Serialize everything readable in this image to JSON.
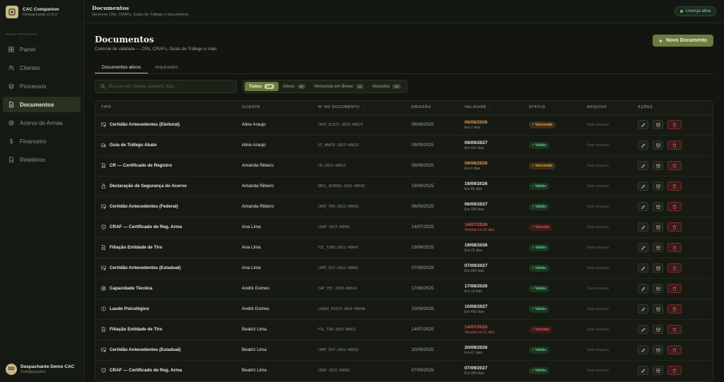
{
  "app": {
    "name": "CAC Companion",
    "version": "Despachante v1.0.0"
  },
  "sidebar": {
    "menu_label": "MENU PRINCIPAL",
    "items": [
      {
        "label": "Painel",
        "icon": "grid-icon",
        "active": false
      },
      {
        "label": "Clientes",
        "icon": "users-icon",
        "active": false
      },
      {
        "label": "Processos",
        "icon": "layers-icon",
        "active": false
      },
      {
        "label": "Documentos",
        "icon": "document-icon",
        "active": true
      },
      {
        "label": "Acervo de Armas",
        "icon": "target-icon",
        "active": false
      },
      {
        "label": "Financeiro",
        "icon": "dollar-icon",
        "active": false
      },
      {
        "label": "Relatórios",
        "icon": "chart-icon",
        "active": false
      }
    ],
    "user": {
      "initials": "DD",
      "name": "Despachante Demo CAC",
      "sub": "Configurações"
    }
  },
  "topbar": {
    "title": "Documentos",
    "subtitle": "Gerencie CRs, CRAFs, Guias de Tráfego e documentos",
    "license": "Licença ativa"
  },
  "page": {
    "title": "Documentos",
    "subtitle": "Controle de validade — CRs, CRAFs, Guias de Tráfego e mais",
    "new_button": "Novo Documento"
  },
  "tabs": [
    {
      "label": "Documentos ativos",
      "active": true
    },
    {
      "label": "Arquivados",
      "active": false
    }
  ],
  "search": {
    "placeholder": "Buscar por cliente, número, tipo...",
    "value": ""
  },
  "filters": [
    {
      "label": "Todos",
      "count": "100",
      "active": true
    },
    {
      "label": "Ativos",
      "count": "84",
      "active": false
    },
    {
      "label": "Vencendo em Breve",
      "count": "11",
      "active": false
    },
    {
      "label": "Vencidos",
      "count": "15",
      "active": false
    }
  ],
  "table": {
    "headers": [
      "TIPO",
      "CLIENTE",
      "Nº DO DOCUMENTO",
      "EMISSÃO",
      "VALIDADE",
      "STATUS",
      "ARQUIVO",
      "AÇÕES"
    ],
    "no_file": "Sem arquivo",
    "rows": [
      {
        "tipo": "Certidão Antecedentes (Eleitoral)",
        "icon": "certificate-icon",
        "cliente": "Aline Araujo",
        "numero": "CERT_ELEIT-2025-00023",
        "emissao": "08/08/2025",
        "validade": "06/08/2026",
        "validade_sub": "Em 2 dias",
        "status": "Vencendo",
        "tone": "warn"
      },
      {
        "tipo": "Guia de Tráfego Abate",
        "icon": "truck-icon",
        "cliente": "Aline Araujo",
        "numero": "GT_ABATE-2023-00023",
        "emissao": "09/09/2025",
        "validade": "09/09/2027",
        "validade_sub": "Em 401 dias",
        "status": "Válido",
        "tone": "ok"
      },
      {
        "tipo": "CR — Certificado de Registro",
        "icon": "document-icon",
        "cliente": "Amanda Ribeiro",
        "numero": "CR-2023-00013",
        "emissao": "08/08/2025",
        "validade": "08/08/2026",
        "validade_sub": "Em 4 dias",
        "status": "Vencendo",
        "tone": "warn"
      },
      {
        "tipo": "Declaração de Segurança do Acervo",
        "icon": "lock-icon",
        "cliente": "Amanda Ribeiro",
        "numero": "DECL_ACERVO-2021-00035",
        "emissao": "19/09/2025",
        "validade": "19/09/2026",
        "validade_sub": "Em 46 dias",
        "status": "Válido",
        "tone": "ok"
      },
      {
        "tipo": "Certidão Antecedentes (Federal)",
        "icon": "certificate-icon",
        "cliente": "Amanda Ribeiro",
        "numero": "CERT_FED-2023-00035",
        "emissao": "06/09/2025",
        "validade": "06/09/2027",
        "validade_sub": "Em 398 dias",
        "status": "Válido",
        "tone": "ok"
      },
      {
        "tipo": "CRAF — Certificado de Reg. Arma",
        "icon": "shield-icon",
        "cliente": "Ana Lima",
        "numero": "CRAF-2023-00001",
        "emissao": "14/07/2025",
        "validade": "14/07/2026",
        "validade_sub": "Vencido há 31 dias",
        "status": "Vencido",
        "tone": "danger"
      },
      {
        "tipo": "Filiação Entidade de Tiro",
        "icon": "document-icon",
        "cliente": "Ana Lima",
        "numero": "FIL_TIRO-2021-00047",
        "emissao": "19/08/2025",
        "validade": "19/08/2026",
        "validade_sub": "Em 15 dias",
        "status": "Válido",
        "tone": "ok"
      },
      {
        "tipo": "Certidão Antecedentes (Estadual)",
        "icon": "certificate-icon",
        "cliente": "Ana Lima",
        "numero": "CERT_EST-2023-00001",
        "emissao": "07/08/2026",
        "validade": "07/09/2027",
        "validade_sub": "Em 399 dias",
        "status": "Válido",
        "tone": "ok"
      },
      {
        "tipo": "Capacidade Técnica",
        "icon": "target-icon",
        "cliente": "André Gomes",
        "numero": "CAP_TEC-2020-00024",
        "emissao": "17/08/2025",
        "validade": "17/08/2026",
        "validade_sub": "Em 13 dias",
        "status": "Válido",
        "tone": "ok"
      },
      {
        "tipo": "Laudo Psicológico",
        "icon": "brain-icon",
        "cliente": "André Gomes",
        "numero": "LAUDO_PSICO-2024-00048",
        "emissao": "10/09/2026",
        "validade": "10/09/2027",
        "validade_sub": "Em 402 dias",
        "status": "Válido",
        "tone": "ok"
      },
      {
        "tipo": "Filiação Entidade de Tiro",
        "icon": "document-icon",
        "cliente": "Beatriz Lima",
        "numero": "FIL_TIR-2025-00011",
        "emissao": "14/07/2025",
        "validade": "14/07/2026",
        "validade_sub": "Vencido há 21 dias",
        "status": "Vencido",
        "tone": "danger"
      },
      {
        "tipo": "Certidão Antecedentes (Estadual)",
        "icon": "certificate-icon",
        "cliente": "Beatriz Lima",
        "numero": "CERT_EST-2023-00031",
        "emissao": "20/09/2025",
        "validade": "20/09/2026",
        "validade_sub": "Em 47 dias",
        "status": "Válido",
        "tone": "ok"
      },
      {
        "tipo": "CRAF — Certificado de Reg. Arma",
        "icon": "shield-icon",
        "cliente": "Beatriz Lima",
        "numero": "CRAF-2021-00091",
        "emissao": "07/09/2026",
        "validade": "07/09/2027",
        "validade_sub": "Em 399 dias",
        "status": "Válido",
        "tone": "ok"
      }
    ]
  },
  "colors": {
    "accent": "#6c7b3f",
    "gold": "#c9b98a",
    "ok": "#5fd67a",
    "warn": "#e79b45",
    "danger": "#e2554d"
  }
}
